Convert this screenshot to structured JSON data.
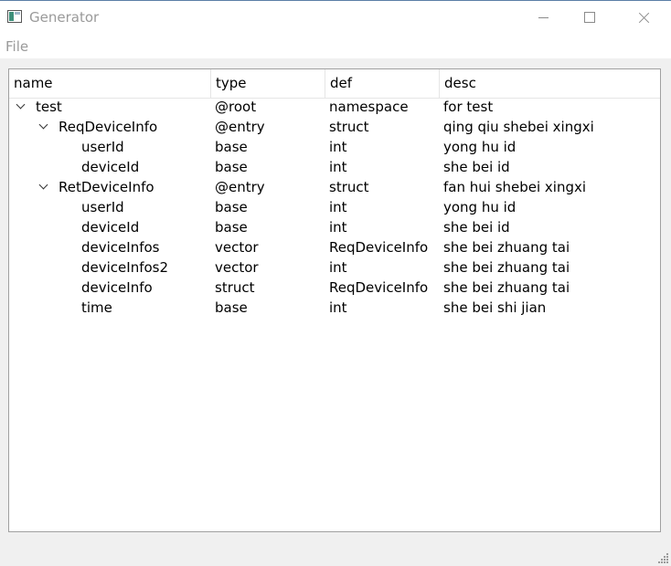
{
  "window": {
    "title": "Generator"
  },
  "menu": {
    "file": "File"
  },
  "tree": {
    "columns": [
      "name",
      "type",
      "def",
      "desc"
    ],
    "rows": [
      {
        "name": "test",
        "type": "@root",
        "def": "namespace",
        "desc": "for test",
        "level": 0,
        "expanded": true
      },
      {
        "name": "ReqDeviceInfo",
        "type": "@entry",
        "def": "struct",
        "desc": "qing qiu shebei xingxi",
        "level": 1,
        "expanded": true
      },
      {
        "name": "userId",
        "type": "base",
        "def": "int",
        "desc": "yong hu id",
        "level": 2
      },
      {
        "name": "deviceId",
        "type": "base",
        "def": "int",
        "desc": "she bei id",
        "level": 2
      },
      {
        "name": "RetDeviceInfo",
        "type": "@entry",
        "def": "struct",
        "desc": "fan hui shebei xingxi",
        "level": 1,
        "expanded": true
      },
      {
        "name": "userId",
        "type": "base",
        "def": "int",
        "desc": "yong hu id",
        "level": 2
      },
      {
        "name": "deviceId",
        "type": "base",
        "def": "int",
        "desc": "she bei id",
        "level": 2
      },
      {
        "name": "deviceInfos",
        "type": "vector",
        "def": "ReqDeviceInfo",
        "desc": "she bei zhuang tai",
        "level": 2
      },
      {
        "name": "deviceInfos2",
        "type": "vector",
        "def": "int",
        "desc": "she bei zhuang tai",
        "level": 2
      },
      {
        "name": "deviceInfo",
        "type": "struct",
        "def": "ReqDeviceInfo",
        "desc": "she bei zhuang tai",
        "level": 2
      },
      {
        "name": "time",
        "type": "base",
        "def": "int",
        "desc": "she bei shi jian",
        "level": 2
      }
    ]
  }
}
